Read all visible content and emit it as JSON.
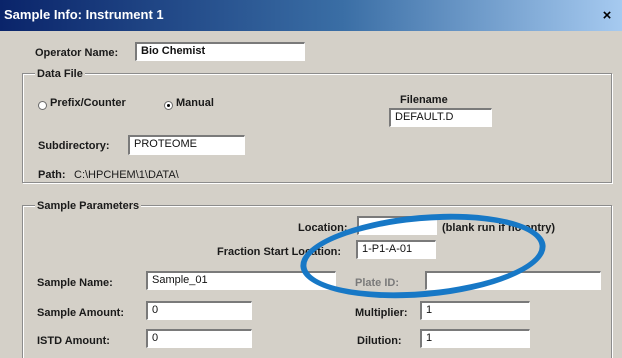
{
  "window": {
    "title": "Sample Info: Instrument 1",
    "close_glyph": "×"
  },
  "operator": {
    "label": "Operator Name:",
    "value": "Bio Chemist"
  },
  "data_file": {
    "group_label": "Data File",
    "mode_options": [
      {
        "label": "Prefix/Counter",
        "selected": false
      },
      {
        "label": "Manual",
        "selected": true
      }
    ],
    "filename_label": "Filename",
    "filename_value": "DEFAULT.D",
    "subdirectory_label": "Subdirectory:",
    "subdirectory_value": "PROTEOME",
    "path_label": "Path:",
    "path_value": "C:\\HPCHEM\\1\\DATA\\"
  },
  "sample_params": {
    "group_label": "Sample Parameters",
    "location_label": "Location:",
    "location_value": "",
    "location_hint": "(blank run if no entry)",
    "fraction_label": "Fraction Start Location:",
    "fraction_value": "1-P1-A-01",
    "sample_name_label": "Sample Name:",
    "sample_name_value": "Sample_01",
    "plate_label": "Plate ID:",
    "plate_value": "",
    "sample_amount_label": "Sample Amount:",
    "sample_amount_value": "0",
    "multiplier_label": "Multiplier:",
    "multiplier_value": "1",
    "istd_label": "ISTD Amount:",
    "istd_value": "0",
    "dilution_label": "Dilution:",
    "dilution_value": "1"
  },
  "annotation": {
    "highlight_color": "#1778c6"
  }
}
